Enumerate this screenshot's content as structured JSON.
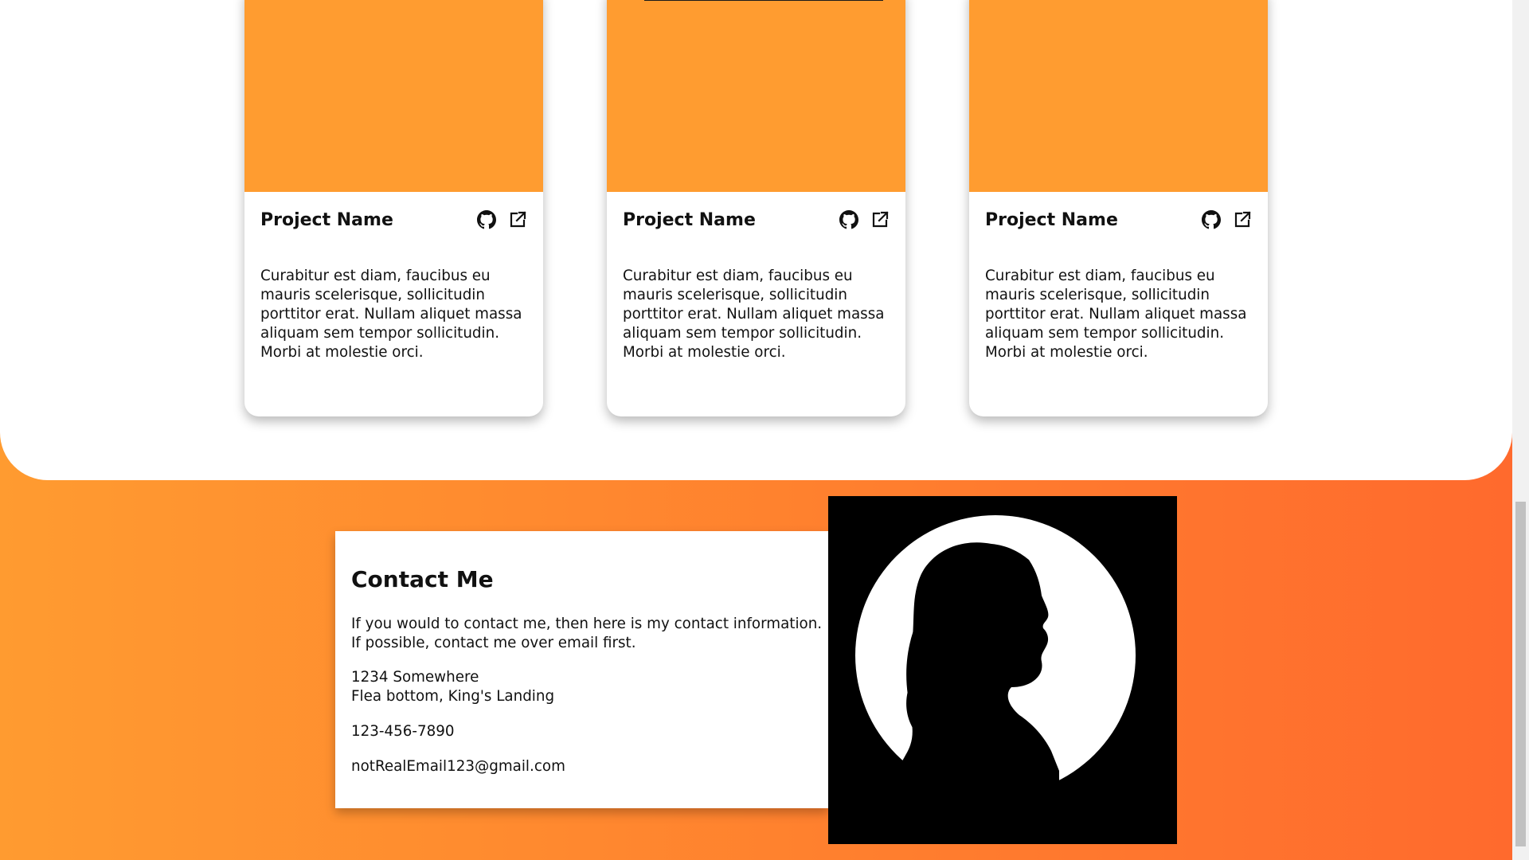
{
  "projects": [
    {
      "title": "Project Name",
      "description": "Curabitur est diam, faucibus eu mauris scelerisque, sollicitudin porttitor erat. Nullam aliquet massa aliquam sem tempor sollicitudin. Morbi at molestie orci.",
      "icons": [
        "github-icon",
        "external-link-icon"
      ]
    },
    {
      "title": "Project Name",
      "description": "Curabitur est diam, faucibus eu mauris scelerisque, sollicitudin porttitor erat. Nullam aliquet massa aliquam sem tempor sollicitudin. Morbi at molestie orci.",
      "icons": [
        "github-icon",
        "external-link-icon"
      ]
    },
    {
      "title": "Project Name",
      "description": "Curabitur est diam, faucibus eu mauris scelerisque, sollicitudin porttitor erat. Nullam aliquet massa aliquam sem tempor sollicitudin. Morbi at molestie orci.",
      "icons": [
        "github-icon",
        "external-link-icon"
      ]
    }
  ],
  "contact": {
    "title": "Contact Me",
    "intro_line1": "If you would to contact me, then here is my contact information.",
    "intro_line2": "If possible, contact me over email first.",
    "address_line1": "1234 Somewhere",
    "address_line2": "Flea bottom, King's Landing",
    "phone": "123-456-7890",
    "email": "notRealEmail123@gmail.com"
  },
  "colors": {
    "card_image": "#ff9c30",
    "gradient_start": "#ff9b30",
    "gradient_end": "#ff6a2d"
  }
}
